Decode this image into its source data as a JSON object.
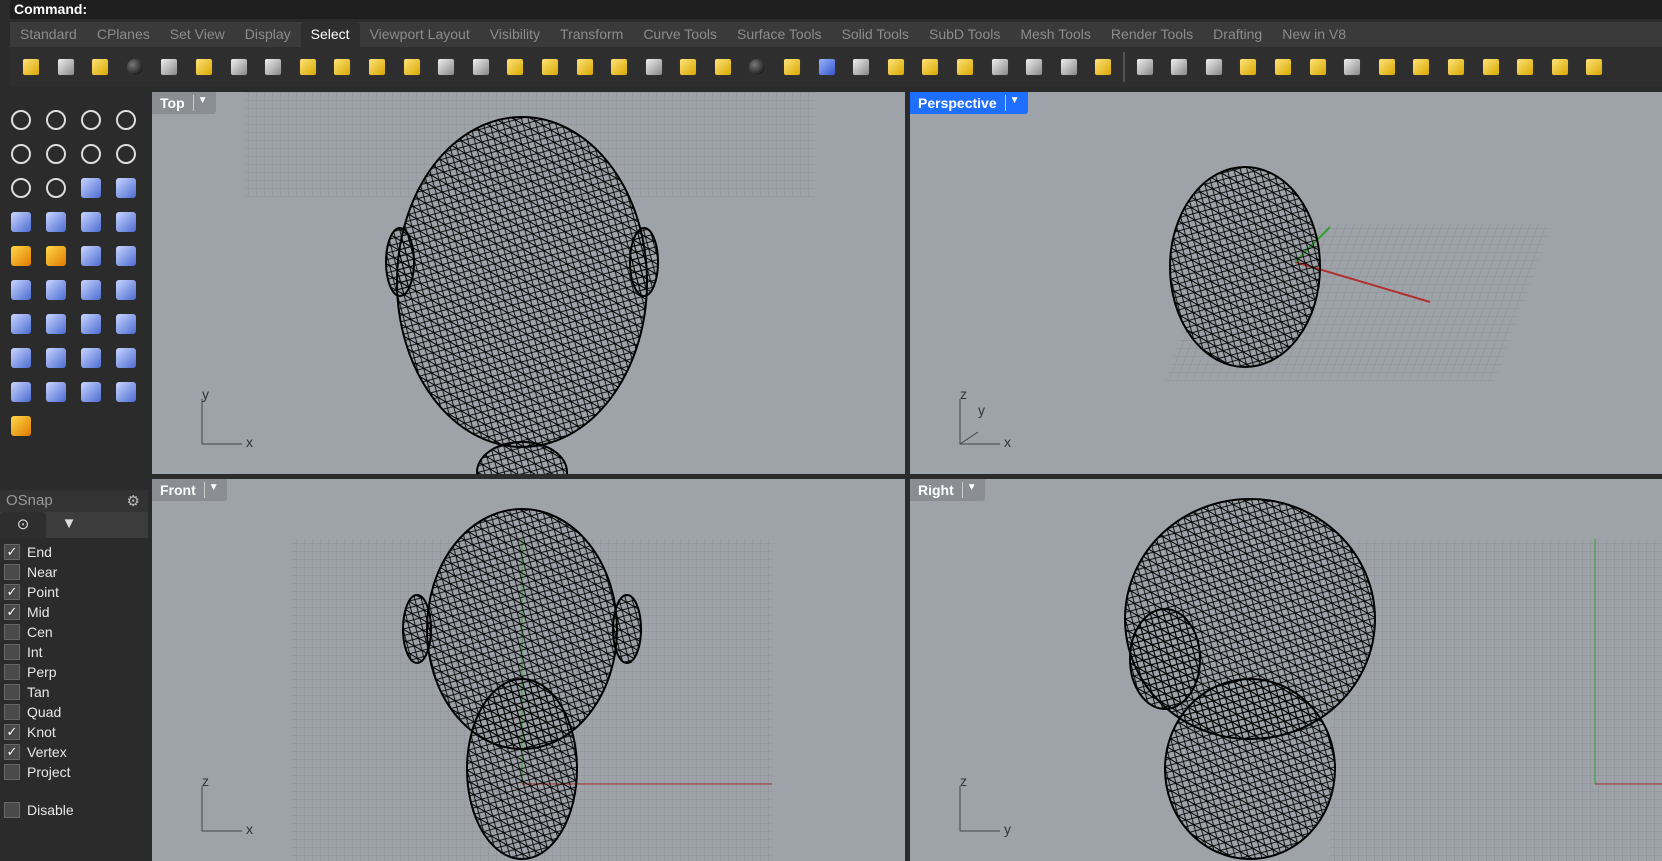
{
  "command": {
    "label": "Command:"
  },
  "tabs": [
    "Standard",
    "CPlanes",
    "Set View",
    "Display",
    "Select",
    "Viewport Layout",
    "Visibility",
    "Transform",
    "Curve Tools",
    "Surface Tools",
    "Solid Tools",
    "SubD Tools",
    "Mesh Tools",
    "Render Tools",
    "Drafting",
    "New in V8"
  ],
  "active_tab": "Select",
  "toolbar_icons": [
    "select-points-icon",
    "select-curves-icon",
    "selection-filter-icon",
    "select-color-icon",
    "select-layer-icon",
    "select-last-icon",
    "select-previous-icon",
    "select-by-name-icon",
    "select-by-id-icon",
    "select-solids-icon",
    "select-by-material-icon",
    "select-surfaces-icon",
    "select-control-points-icon",
    "select-point-cloud-icon",
    "select-polysurfaces-icon",
    "select-duplicates-icon",
    "select-lights-icon",
    "select-hatch-icon",
    "select-dims-icon",
    "select-annotations-icon",
    "select-groups-icon",
    "select-sphere-icon",
    "select-blocks-icon",
    "select-cameras-icon",
    "select-details-icon",
    "select-planar-icon",
    "select-meshes-icon",
    "select-subd-icon",
    "select-spiral-icon",
    "select-open-icon",
    "select-linked-icon",
    "select-pyramid-icon",
    "window-select-icon",
    "select-visible-icon",
    "select-box-icon",
    "select-sun-icon",
    "select-curves-join-icon",
    "select-brush-icon",
    "zoom-select-icon",
    "select-fence-icon",
    "select-block-u-icon",
    "select-tag-icon",
    "select-key-icon",
    "select-pin-icon",
    "select-linked-pins-icon",
    "select-cube-icon"
  ],
  "toolbox_icons": [
    "select-arrow-icon",
    "point-icon",
    "polyline-icon",
    "curve-icon",
    "circle-icon",
    "ellipse-icon",
    "polygon-icon",
    "rectangle-icon",
    "hexagon-icon",
    "fillet-icon",
    "surface-icon",
    "extrude-icon",
    "box-icon",
    "boolean-icon",
    "cylinder-icon",
    "mesh-icon",
    "explode-icon",
    "trim-icon",
    "split-icon",
    "join-icon",
    "group-icon",
    "rebuild-icon",
    "offset-icon",
    "arc-icon",
    "text-icon",
    "scale-icon",
    "array-icon",
    "mirror-icon",
    "solid-edit-icon",
    "move-icon",
    "grid-icon",
    "dimension-icon",
    "layer-icon",
    "walk-icon",
    "check-icon",
    "analyze-icon",
    "light-icon"
  ],
  "osnap": {
    "title": "OSnap",
    "items": [
      {
        "label": "End",
        "checked": true
      },
      {
        "label": "Near",
        "checked": false
      },
      {
        "label": "Point",
        "checked": true
      },
      {
        "label": "Mid",
        "checked": true
      },
      {
        "label": "Cen",
        "checked": false
      },
      {
        "label": "Int",
        "checked": false
      },
      {
        "label": "Perp",
        "checked": false
      },
      {
        "label": "Tan",
        "checked": false
      },
      {
        "label": "Quad",
        "checked": false
      },
      {
        "label": "Knot",
        "checked": true
      },
      {
        "label": "Vertex",
        "checked": true
      },
      {
        "label": "Project",
        "checked": false
      }
    ],
    "disable": {
      "label": "Disable",
      "checked": false
    }
  },
  "viewports": [
    {
      "name": "Top",
      "active": false,
      "axes": [
        "y",
        "x"
      ]
    },
    {
      "name": "Perspective",
      "active": true,
      "axes": [
        "z",
        "y",
        "x"
      ]
    },
    {
      "name": "Front",
      "active": false,
      "axes": [
        "z",
        "x"
      ]
    },
    {
      "name": "Right",
      "active": false,
      "axes": [
        "z",
        "y"
      ]
    }
  ],
  "colors": {
    "accent": "#1e6fff",
    "viewport_bg": "#9ea3a9",
    "x_axis": "#b03030",
    "y_axis": "#30a030"
  }
}
